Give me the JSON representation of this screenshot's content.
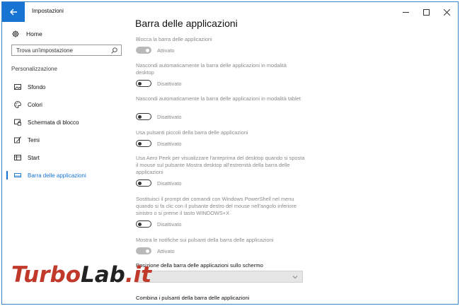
{
  "window": {
    "title": "Impostazioni"
  },
  "sidebar": {
    "home_label": "Home",
    "search_placeholder": "Trova un'impostazione",
    "section_label": "Personalizzazione",
    "items": [
      {
        "label": "Sfondo",
        "icon": "image-icon"
      },
      {
        "label": "Colori",
        "icon": "palette-icon"
      },
      {
        "label": "Schermata di blocco",
        "icon": "lock-screen-icon"
      },
      {
        "label": "Temi",
        "icon": "brush-icon"
      },
      {
        "label": "Start",
        "icon": "start-icon"
      },
      {
        "label": "Barra delle applicazioni",
        "icon": "taskbar-icon",
        "active": true
      }
    ]
  },
  "main": {
    "title": "Barra delle applicazioni",
    "settings": [
      {
        "desc": "Blocca la barra delle applicazioni",
        "state": "Attivato",
        "on": true
      },
      {
        "desc": "Nascondi automaticamente la barra delle applicazioni in modalità desktop",
        "state": "Disattivato",
        "on": false
      },
      {
        "desc": "Nascondi automaticamente la barra delle applicazioni in modalità tablet",
        "state": "Disattivato",
        "on": false
      },
      {
        "desc": "Usa pulsanti piccoli della barra delle applicazioni",
        "state": "Disattivato",
        "on": false
      },
      {
        "desc": "Usa Aero Peek per visualizzare l'anteprima del desktop quando si sposta il mouse sul pulsante Mostra desktop all'estremità della barra delle applicazioni",
        "state": "Disattivato",
        "on": false
      },
      {
        "desc": "Sostituisci il prompt dei comandi con Windows PowerShell nel menu quando si fa clic con il pulsante destro del mouse nell'angolo inferiore sinistro o si preme il tasto WINDOWS+X",
        "state": "Disattivato",
        "on": false
      },
      {
        "desc": "Mostra le notifiche sui pulsanti della barra delle applicazioni",
        "state": "Attivato",
        "on": true
      }
    ],
    "position_label": "Posizione della barra delle applicazioni sullo schermo",
    "combine_label": "Combina i pulsanti della barra delle applicazioni"
  },
  "watermark": {
    "part1": "Turbo",
    "part2": "Lab",
    "part3": ".it"
  },
  "colors": {
    "accent": "#1874d2",
    "watermark_red": "#c0392b"
  }
}
